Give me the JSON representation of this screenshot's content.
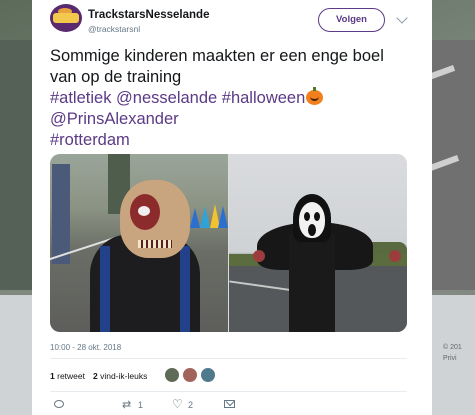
{
  "background": {
    "copyright_lines": [
      "© 201",
      "Privi"
    ]
  },
  "tweet": {
    "author": {
      "display_name": "TrackstarsNesselande",
      "handle": "@trackstarsnl"
    },
    "follow_label": "Volgen",
    "text_lines": [
      {
        "plain": "Sommige kinderen maakten er een enge boel"
      },
      {
        "plain": "van op de training"
      },
      {
        "tags": "#atletiek @nesselande #halloween",
        "emoji": "pumpkin"
      },
      {
        "tags": "@PrinsAlexander"
      },
      {
        "tags": "#rotterdam"
      }
    ],
    "timestamp": "10:00 - 28 okt. 2018",
    "stats": {
      "retweets_count": "1",
      "retweets_label": "retweet",
      "likes_count": "2",
      "likes_label": "vind-ik-leuks"
    },
    "actions": {
      "retweet_count": "1",
      "like_count": "2"
    }
  },
  "colors": {
    "accent": "#5b3a86",
    "muted": "#657786"
  }
}
